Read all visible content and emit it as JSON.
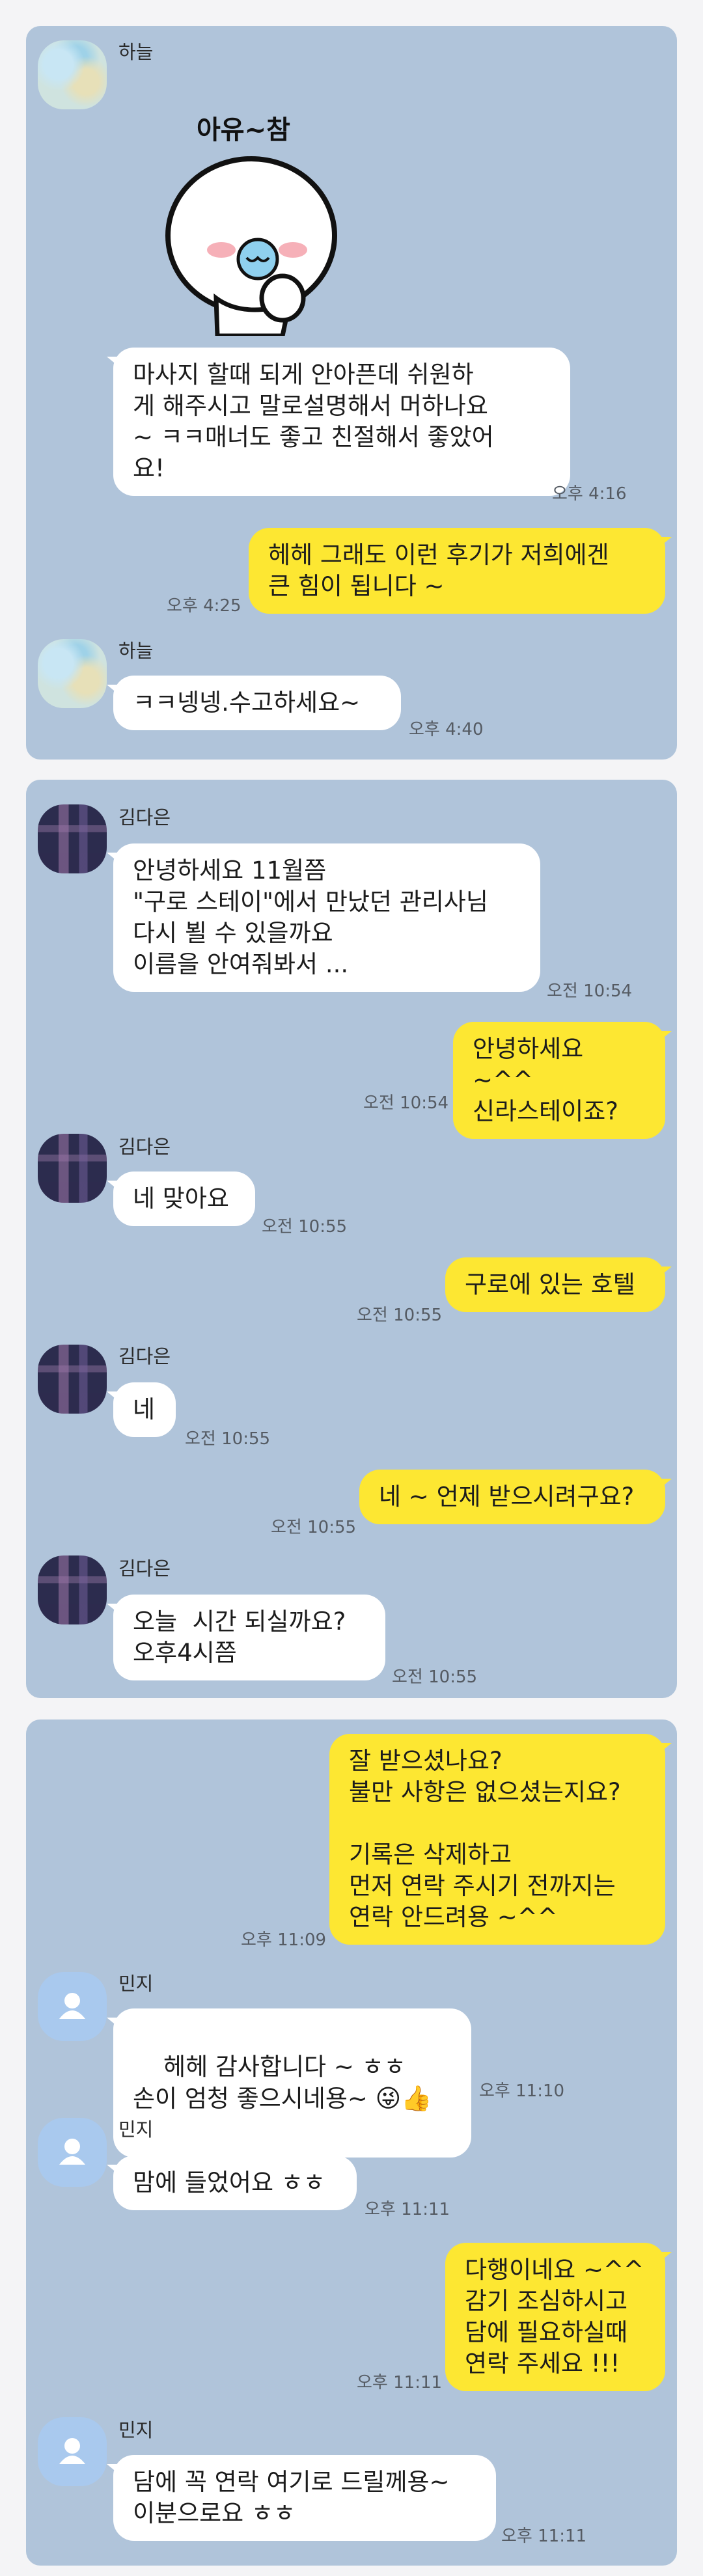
{
  "chats": [
    {
      "messages": [
        {
          "sender": "하늘",
          "sticker_text": "아유~참"
        },
        {
          "text": "마사지 할때 되게 안아픈데 쉬원하\n게 해주시고 말로설명해서 머하나요\n~ ㅋㅋ매너도 좋고 친절해서 좋았어\n요!",
          "time": "오후 4:16"
        },
        {
          "text": "헤헤 그래도 이런 후기가 저희에겐\n큰 힘이 됩니다 ~",
          "time": "오후 4:25"
        },
        {
          "sender": "하늘",
          "text": "ㅋㅋ넹넹.수고하세요~",
          "time": "오후 4:40"
        }
      ]
    },
    {
      "messages": [
        {
          "sender": "김다은",
          "text": "안녕하세요 11월쯤\n\"구로 스테이\"에서 만났던 관리사님\n다시 뵐 수 있을까요\n이름을 안여줘봐서 ...",
          "time": "오전 10:54"
        },
        {
          "text": "안녕하세요 ~^^\n신라스테이죠?",
          "time": "오전 10:54"
        },
        {
          "sender": "김다은",
          "text": "네 맞아요",
          "time": "오전 10:55"
        },
        {
          "text": "구로에 있는 호텔",
          "time": "오전 10:55"
        },
        {
          "sender": "김다은",
          "text": "네",
          "time": "오전 10:55"
        },
        {
          "text": "네 ~ 언제 받으시려구요?",
          "time": "오전 10:55"
        },
        {
          "sender": "김다은",
          "text": "오늘  시간 되실까요?\n오후4시쯤",
          "time": "오전 10:55"
        }
      ]
    },
    {
      "messages": [
        {
          "text": "잘 받으셨나요?\n불만 사항은 없으셨는지요?\n\n기록은 삭제하고\n먼저 연락 주시기 전까지는\n연락 안드려용 ~^^",
          "time": "오후 11:09"
        },
        {
          "sender": "민지",
          "text": "헤헤 감사합니다 ~ ㅎㅎ\n손이 엄청 좋으시네용~ ",
          "emojis": "😜👍",
          "time": "오후 11:10"
        },
        {
          "sender": "민지",
          "text": "맘에 들었어요 ㅎㅎ",
          "time": "오후 11:11"
        },
        {
          "text": "다행이네요 ~^^\n감기 조심하시고\n담에 필요하실때\n연락 주세요 !!!",
          "time": "오후 11:11"
        },
        {
          "sender": "민지",
          "text": "담에 꼭 연락 여기로 드릴께용~\n이분으로요 ㅎㅎ",
          "time": "오후 11:11"
        }
      ]
    }
  ],
  "colors": {
    "chat_background": "#b0c4da",
    "incoming_bubble": "#ffffff",
    "outgoing_bubble": "#fde732",
    "page_background": "#f4f4f6"
  },
  "icons": [
    "blurred-avatar",
    "default-person-avatar",
    "white-face-sticker"
  ]
}
